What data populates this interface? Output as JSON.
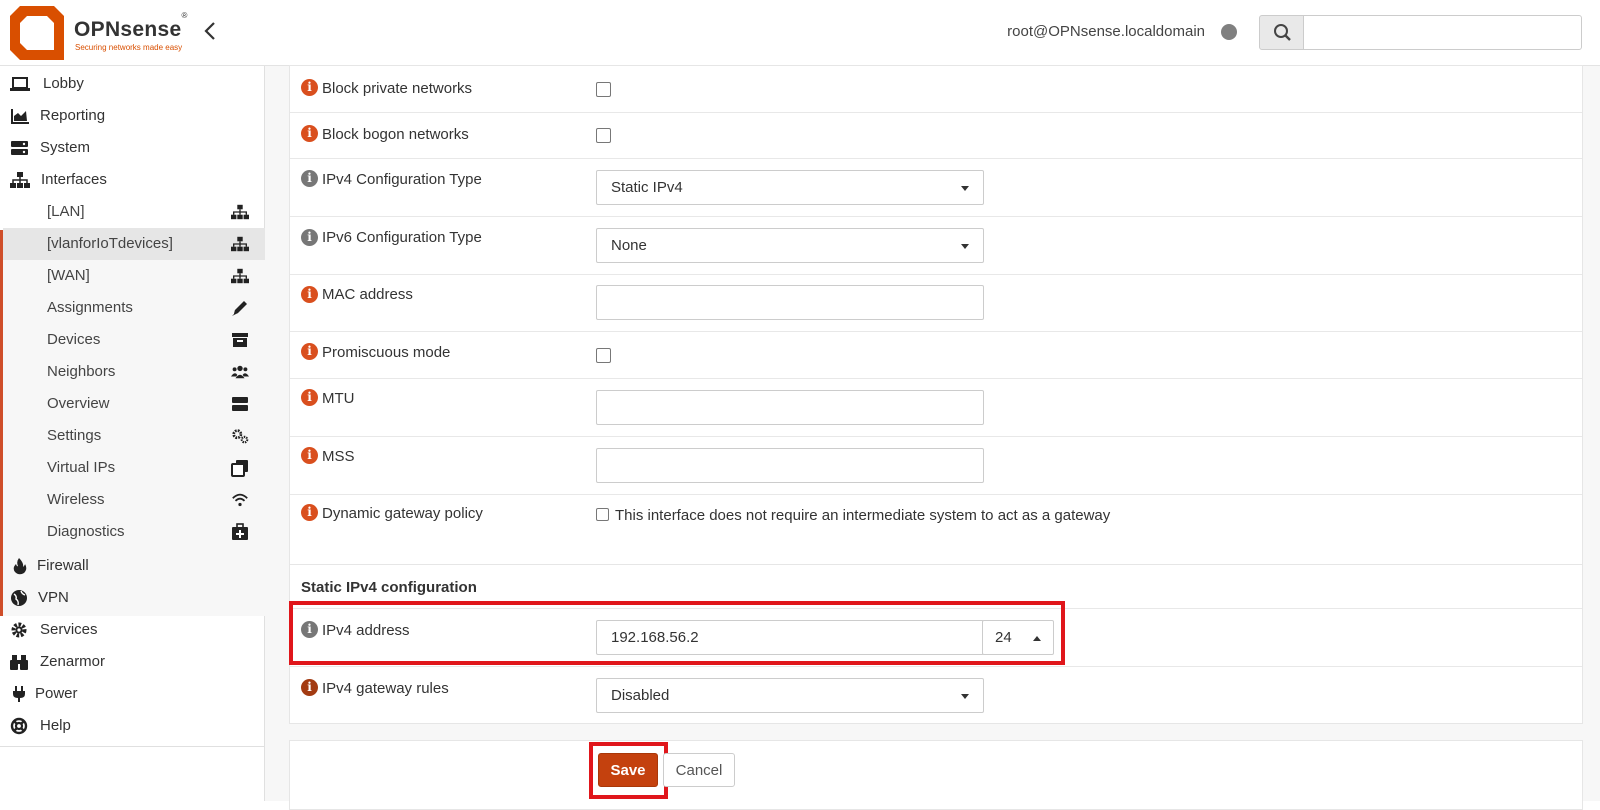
{
  "header": {
    "brand": "OPNsense",
    "trademark": "®",
    "tagline": "Securing networks made easy",
    "user": "root@OPNsense.localdomain",
    "search_placeholder": "",
    "colors": {
      "brand_orange": "#d94f00",
      "status_dot": "#808080"
    }
  },
  "sidebar": {
    "items": [
      {
        "label": "Lobby",
        "icon": "laptop-icon"
      },
      {
        "label": "Reporting",
        "icon": "area-chart-icon"
      },
      {
        "label": "System",
        "icon": "server-icon"
      },
      {
        "label": "Interfaces",
        "icon": "sitemap-icon"
      }
    ],
    "interfaces_sub": [
      {
        "label": "[LAN]",
        "icon": "sitemap-icon"
      },
      {
        "label": "[vlanforIoTdevices]",
        "icon": "sitemap-icon",
        "active": true
      },
      {
        "label": "[WAN]",
        "icon": "sitemap-icon"
      },
      {
        "label": "Assignments",
        "icon": "pencil-icon"
      },
      {
        "label": "Devices",
        "icon": "archive-icon"
      },
      {
        "label": "Neighbors",
        "icon": "users-icon"
      },
      {
        "label": "Overview",
        "icon": "server-icon"
      },
      {
        "label": "Settings",
        "icon": "cogs-icon"
      },
      {
        "label": "Virtual IPs",
        "icon": "clone-icon"
      },
      {
        "label": "Wireless",
        "icon": "wifi-icon"
      },
      {
        "label": "Diagnostics",
        "icon": "medkit-icon"
      }
    ],
    "bottom_items": [
      {
        "label": "Firewall",
        "icon": "fire-icon"
      },
      {
        "label": "VPN",
        "icon": "globe-icon"
      },
      {
        "label": "Services",
        "icon": "cog-icon"
      },
      {
        "label": "Zenarmor",
        "icon": "binoculars-icon"
      },
      {
        "label": "Power",
        "icon": "plug-icon"
      },
      {
        "label": "Help",
        "icon": "life-ring-icon"
      }
    ]
  },
  "form": {
    "block_private": {
      "label": "Block private networks",
      "checked": false
    },
    "block_bogon": {
      "label": "Block bogon networks",
      "checked": false
    },
    "ipv4_type": {
      "label": "IPv4 Configuration Type",
      "value": "Static IPv4"
    },
    "ipv6_type": {
      "label": "IPv6 Configuration Type",
      "value": "None"
    },
    "mac": {
      "label": "MAC address",
      "value": ""
    },
    "promiscuous": {
      "label": "Promiscuous mode",
      "checked": false
    },
    "mtu": {
      "label": "MTU",
      "value": ""
    },
    "mss": {
      "label": "MSS",
      "value": ""
    },
    "dynamic_gw": {
      "label": "Dynamic gateway policy",
      "checkbox_text": "This interface does not require an intermediate system to act as a gateway",
      "checked": false
    },
    "static_section_title": "Static IPv4 configuration",
    "ipv4_address": {
      "label": "IPv4 address",
      "value": "192.168.56.2",
      "subnet": "24"
    },
    "ipv4_gateway_rules": {
      "label": "IPv4 gateway rules",
      "value": "Disabled"
    },
    "buttons": {
      "save": "Save",
      "cancel": "Cancel"
    },
    "colors": {
      "info_orange": "#d94f1e",
      "info_gray": "#777777",
      "save_button": "#c4410e",
      "highlight": "#e0161b"
    }
  }
}
